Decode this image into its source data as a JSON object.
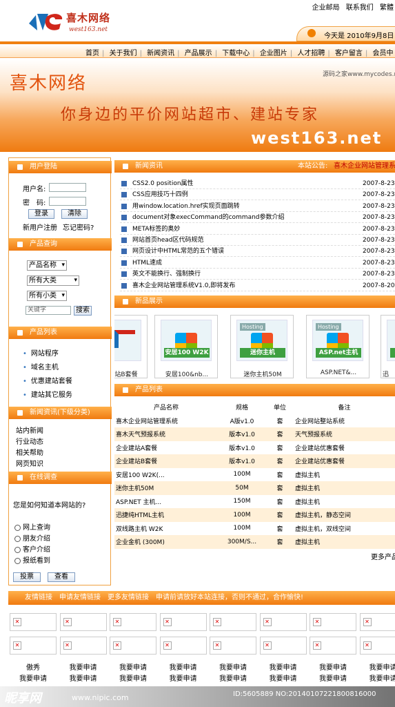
{
  "header": {
    "logo_text": "喜木网络",
    "logo_url": "west163.net",
    "top_links": [
      "企业邮局",
      "联系我们",
      "繁體"
    ],
    "date": "今天是 2010年9月8日 星"
  },
  "nav": [
    "首页",
    "关于我们",
    "新闻资讯",
    "产品展示",
    "下载中心",
    "企业图片",
    "人才招聘",
    "客户留言",
    "会员中"
  ],
  "banner": {
    "title": "喜木网络",
    "slogan": "你身边的平价网站超市、建站专家",
    "url": "west163.net",
    "source": "源码之家www.mycodes.net"
  },
  "login": {
    "header": "用户登陆",
    "user_label": "用户名:",
    "pass_label": "密　码:",
    "login_btn": "登录",
    "clear_btn": "清除",
    "register": "新用户注册",
    "forgot": "忘记密码?"
  },
  "search": {
    "header": "产品查询",
    "select1": "产品名称",
    "select2": "所有大类",
    "select3": "所有小类",
    "keyword_placeholder": "关键字",
    "search_btn": "搜索"
  },
  "product_list_side": {
    "header": "产品列表",
    "items": [
      "网站程序",
      "域名主机",
      "优惠建站套餐",
      "建站其它服务"
    ]
  },
  "news_side": {
    "header": "新闻资讯(下级分类)",
    "items": [
      "站内新闻",
      "行业动态",
      "相关帮助",
      "网页知识"
    ]
  },
  "survey": {
    "header": "在线调查",
    "question": "您是如何知道本网站的?",
    "options": [
      "网上查询",
      "朋友介绍",
      "客户介绍",
      "报纸看到"
    ],
    "vote_btn": "投票",
    "view_btn": "查看"
  },
  "news": {
    "header": "新闻资讯",
    "notice_label": "本站公告:",
    "notice_text": "喜木企业网站管理系统",
    "rows": [
      {
        "title": "CSS2.0 position属性",
        "date": "2007-8-23"
      },
      {
        "title": "CSS应用技巧十四例",
        "date": "2007-8-23"
      },
      {
        "title": "用window.location.href实现页面跳转",
        "date": "2007-8-23"
      },
      {
        "title": "document对象execCommand的command参数介绍",
        "date": "2007-8-23"
      },
      {
        "title": "META标签的奥妙",
        "date": "2007-8-23"
      },
      {
        "title": "网站首页head区代码规范",
        "date": "2007-8-23"
      },
      {
        "title": "网页设计中HTML常范的五个错误",
        "date": "2007-8-23"
      },
      {
        "title": "HTML速成",
        "date": "2007-8-23"
      },
      {
        "title": "英文不能换行、强制换行",
        "date": "2007-8-23"
      },
      {
        "title": "喜木企业网站管理系统V1.0,即将发布",
        "date": "2007-8-20"
      }
    ]
  },
  "showcase": {
    "header": "新品展示",
    "items": [
      {
        "caption": "站B套餐",
        "box": "",
        "ribbon": ""
      },
      {
        "caption": "安居100&nb...",
        "box": "",
        "ribbon": "安居100 W2K"
      },
      {
        "caption": "迷你主机50M",
        "box": "Hosting",
        "ribbon": "迷你主机"
      },
      {
        "caption": "ASP.NET&...",
        "box": "Hosting",
        "ribbon": "ASP.net主机"
      },
      {
        "caption": "迅",
        "box": "",
        "ribbon": "纯"
      }
    ]
  },
  "product_table": {
    "header": "产品列表",
    "columns": [
      "产品名称",
      "规格",
      "单位",
      "备注"
    ],
    "rows": [
      [
        "喜木企业网站管理系统",
        "A版v1.0",
        "套",
        "企业网站整站系统"
      ],
      [
        "喜木天气预报系统",
        "版本v1.0",
        "套",
        "天气预报系统"
      ],
      [
        "企业建站A套餐",
        "版本v1.0",
        "套",
        "企业建站优惠套餐"
      ],
      [
        "企业建站B套餐",
        "版本v1.0",
        "套",
        "企业建站优惠套餐"
      ],
      [
        "安居100 W2K(...",
        "100M",
        "套",
        "虚拟主机"
      ],
      [
        "迷你主机50M",
        "50M",
        "套",
        "虚拟主机"
      ],
      [
        "ASP.NET 主机...",
        "150M",
        "套",
        "虚拟主机"
      ],
      [
        "迅捷纯HTML主机",
        "100M",
        "套",
        "虚拟主机，静态空间"
      ],
      [
        "双线路主机 W2K",
        "100M",
        "套",
        "虚拟主机，双线空间"
      ],
      [
        "企业金机 (300M)",
        "300M/S...",
        "套",
        "虚拟主机"
      ]
    ],
    "more": "更多产品"
  },
  "links": {
    "bar_text": "友情链接　申请友情链接　更多友情链接　申请前请放好本站连接，否则不通过，合作愉快!",
    "text_row1": [
      "傲秀",
      "我要申请",
      "我要申请",
      "我要申请",
      "我要申请",
      "我要申请",
      "我要申请",
      "我要申请"
    ],
    "text_row2": [
      "我要申请",
      "我要申请",
      "我要申请",
      "我要申请",
      "我要申请",
      "我要申请",
      "我要申请",
      "我要申请"
    ]
  },
  "watermark": {
    "logo": "昵享网",
    "url": "www.nipic.com",
    "id": "ID:5605889 NO:20140107221800816000"
  },
  "colors": {
    "accent": "#f07a10",
    "title_red": "#e2530e"
  }
}
